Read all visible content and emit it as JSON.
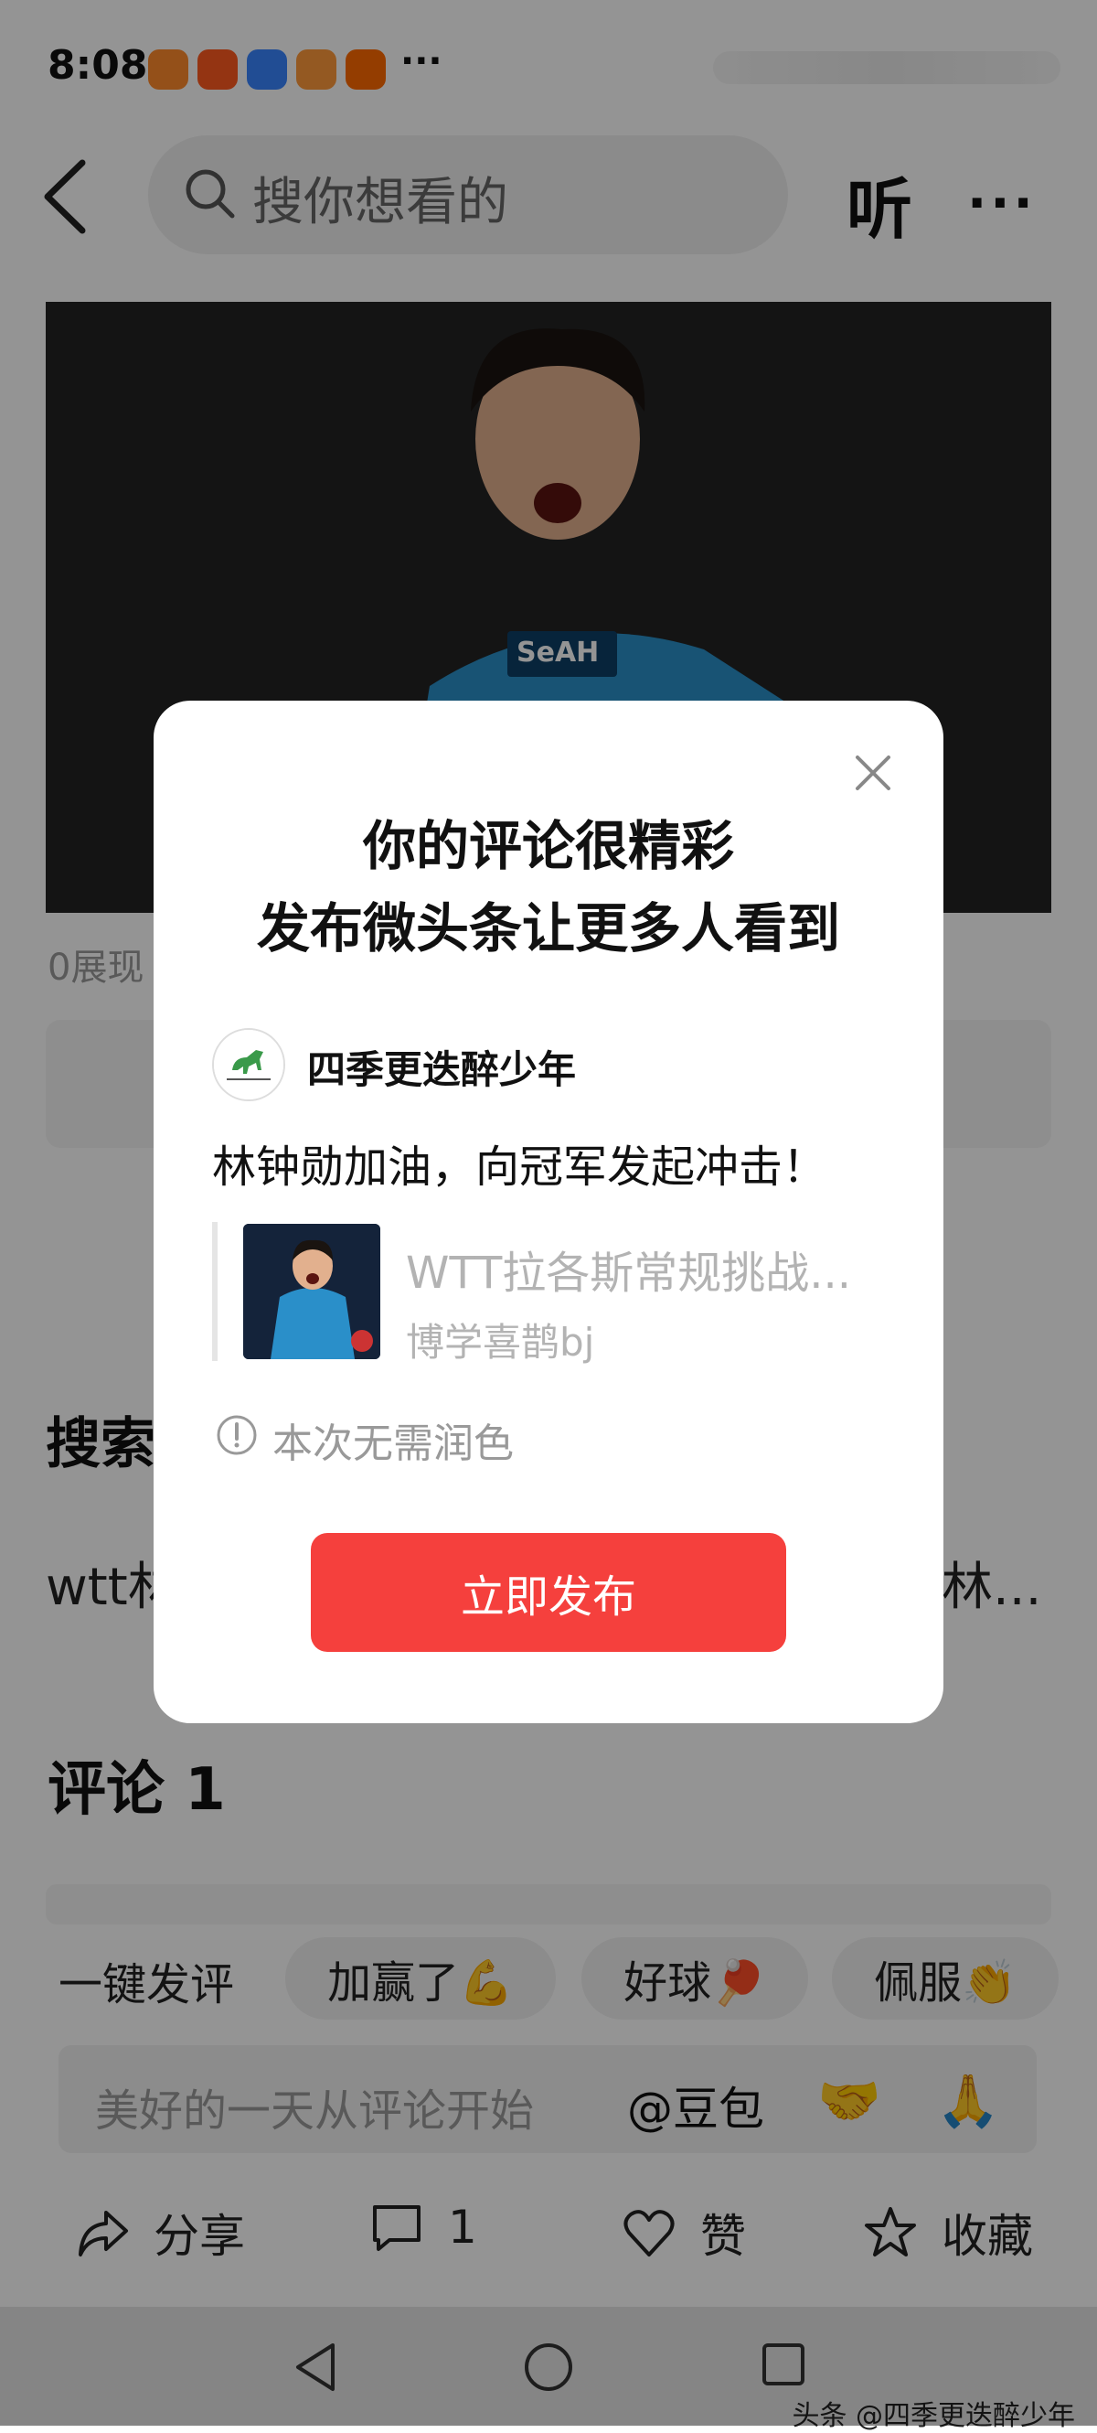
{
  "status": {
    "time": "8:08",
    "extra": "···"
  },
  "header": {
    "search_placeholder": "搜你想看的",
    "listen_label": "听",
    "more_label": "···"
  },
  "video": {
    "views_text": "0展现"
  },
  "search_section": {
    "heading": "搜索",
    "left_chip": "wtt林",
    "right_chip": "林..."
  },
  "comments": {
    "title": "评论 1"
  },
  "quick_reply": {
    "label": "一键发评",
    "chips": [
      "加赢了💪",
      "好球🏓",
      "佩服👏"
    ]
  },
  "input": {
    "placeholder": "美好的一天从评论开始",
    "at_label": "@豆包",
    "emoji_1": "🤝",
    "emoji_2": "🙏"
  },
  "bottom_bar": {
    "share": "分享",
    "comment_count": "1",
    "like": "赞",
    "favorite": "收藏"
  },
  "watermark": "头条 @四季更迭醉少年",
  "modal": {
    "title_line1": "你的评论很精彩",
    "title_line2": "发布微头条让更多人看到",
    "author": "四季更迭醉少年",
    "comment": "林钟勋加油，向冠军发起冲击！",
    "card_title": "WTT拉各斯常规挑战...",
    "card_source": "博学喜鹊bj",
    "info": "本次无需润色",
    "publish_label": "立即发布"
  },
  "colors": {
    "accent": "#f5403d",
    "overlay": "rgba(0,0,0,0.42)"
  }
}
